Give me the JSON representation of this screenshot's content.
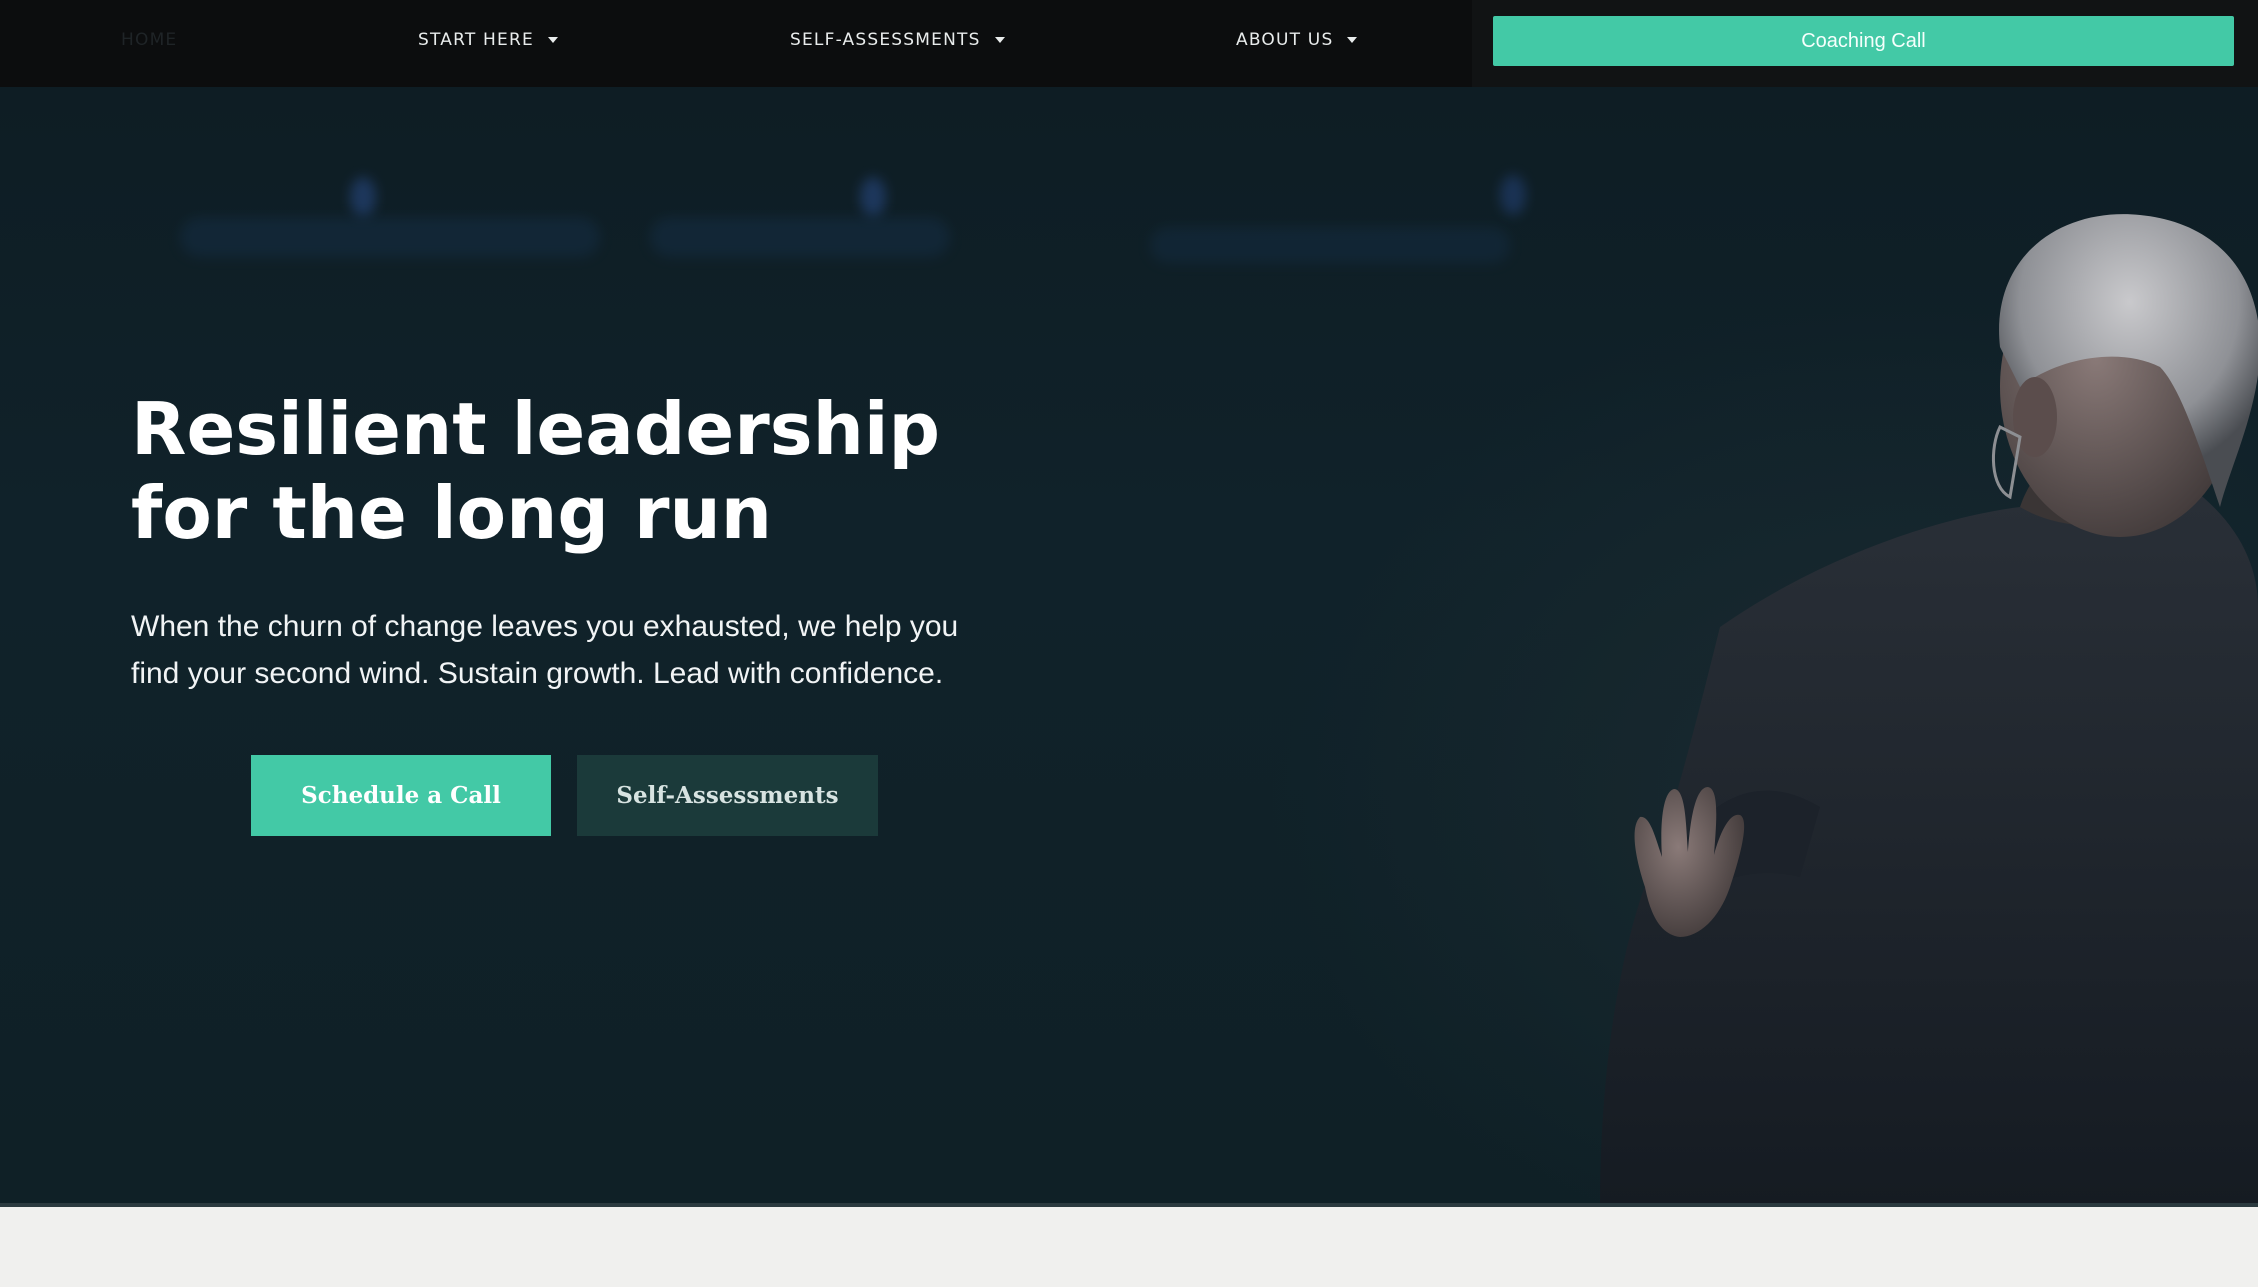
{
  "nav": {
    "items": [
      {
        "label": "HOME",
        "has_caret": false
      },
      {
        "label": "START HERE",
        "has_caret": true
      },
      {
        "label": "SELF-ASSESSMENTS",
        "has_caret": true
      },
      {
        "label": "ABOUT US",
        "has_caret": true
      }
    ],
    "cta_label": "Coaching Call",
    "caret_icon": "caret-down-icon"
  },
  "hero": {
    "title": "Resilient leadership for the long run",
    "subtitle": "When the churn of change leaves you exhausted, we help you find your second wind. Sustain growth. Lead with confidence.",
    "primary_button": "Schedule a Call",
    "secondary_button": "Self-Assessments"
  },
  "colors": {
    "accent": "#43c9a6",
    "nav_bg": "#0c0d0e",
    "hero_bg": "#10222a",
    "secondary_button_bg": "#1b3a3a",
    "footer_bg": "#f0f0ee"
  }
}
